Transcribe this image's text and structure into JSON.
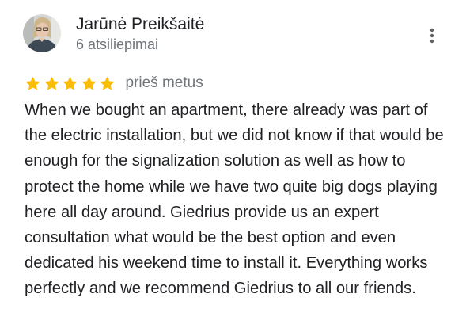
{
  "reviewer": {
    "name": "Jarūnė Preikšaitė",
    "review_count": "6 atsiliepimai",
    "avatar_icon": "user-photo-avatar"
  },
  "menu": {
    "icon": "more-vert-icon"
  },
  "review": {
    "rating": 5,
    "rating_max": 5,
    "star_color": "#fbbc04",
    "date": "prieš metus",
    "text": "When we bought an apartment, there already was part of the electric installation, but we did not know if that would be enough for the signalization solution as well as how to protect the home while we have two quite big dogs playing here all day around. Giedrius provide us an expert consultation what would be the best option and even dedicated his weekend time to install it. Everything works perfectly and we recommend Giedrius to all our friends."
  }
}
